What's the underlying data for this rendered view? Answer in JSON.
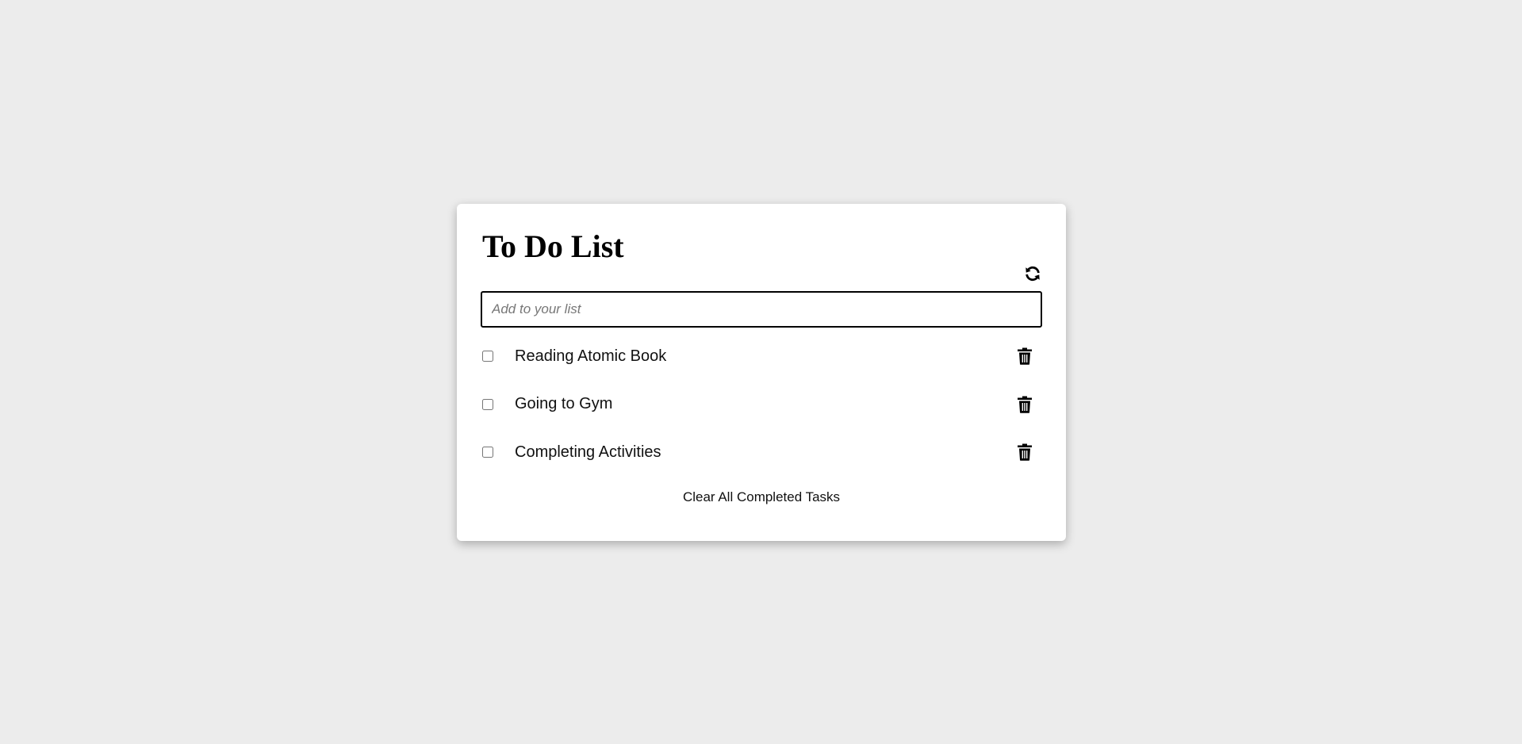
{
  "app": {
    "title": "To Do List"
  },
  "toolbar": {
    "refresh_icon": "refresh-icon"
  },
  "input": {
    "placeholder": "Add to your list",
    "value": ""
  },
  "tasks": [
    {
      "label": "Reading Atomic Book",
      "completed": false
    },
    {
      "label": "Going to Gym",
      "completed": false
    },
    {
      "label": "Completing Activities",
      "completed": false
    }
  ],
  "icons": {
    "delete": "trash-icon"
  },
  "footer": {
    "clear_label": "Clear All Completed Tasks"
  }
}
